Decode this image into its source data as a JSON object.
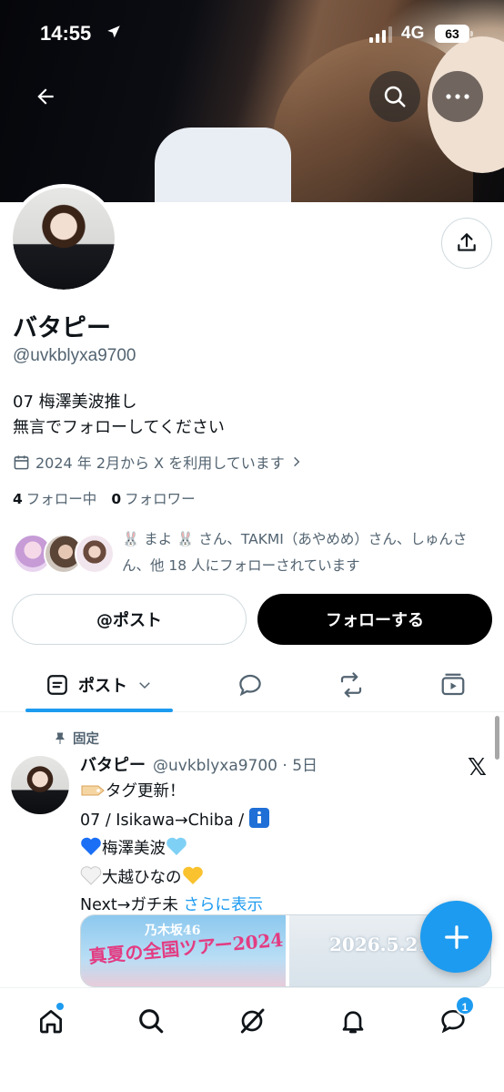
{
  "status_bar": {
    "time": "14:55",
    "network": "4G",
    "battery": "63"
  },
  "profile": {
    "name": "バタピー",
    "handle": "@uvkblyxa9700",
    "bio_lines": [
      "07 梅澤美波推し",
      "無言でフォローしてください"
    ],
    "joined": "2024 年 2月から X を利用しています",
    "following_count": "4",
    "following_label": "フォロー中",
    "followers_count": "0",
    "followers_label": "フォロワー",
    "followed_by_text": "🐰 まよ 🐰 さん、TAKMI（あやめめ）さん、しゅんさん、他 18 人にフォローされています"
  },
  "actions": {
    "post_label": "@ポスト",
    "follow_label": "フォローする"
  },
  "tabs": [
    {
      "label": "ポスト",
      "icon": "posts-icon"
    },
    {
      "icon": "replies-icon"
    },
    {
      "icon": "reposts-icon"
    },
    {
      "icon": "media-icon"
    }
  ],
  "pinned_post": {
    "pinned_label": "固定",
    "author_name": "バタピー",
    "meta": "@uvkblyxa9700 · 5日",
    "lines": {
      "l1": "タグ更新！",
      "l2": "07 / Isikawa→Chiba / ",
      "l3": "梅澤美波",
      "l4": "大越ひなの",
      "l5": "Next→ガチ未",
      "more": "さらに表示"
    },
    "media": {
      "left_caption": "真夏の全国ツアー2024",
      "left_top": "乃木坂46",
      "right_caption": "2026.5.21"
    }
  },
  "bottom_nav": {
    "messages_badge": "1"
  },
  "colors": {
    "accent": "#1d9bf0",
    "text": "#0f1419",
    "secondary": "#536471"
  }
}
